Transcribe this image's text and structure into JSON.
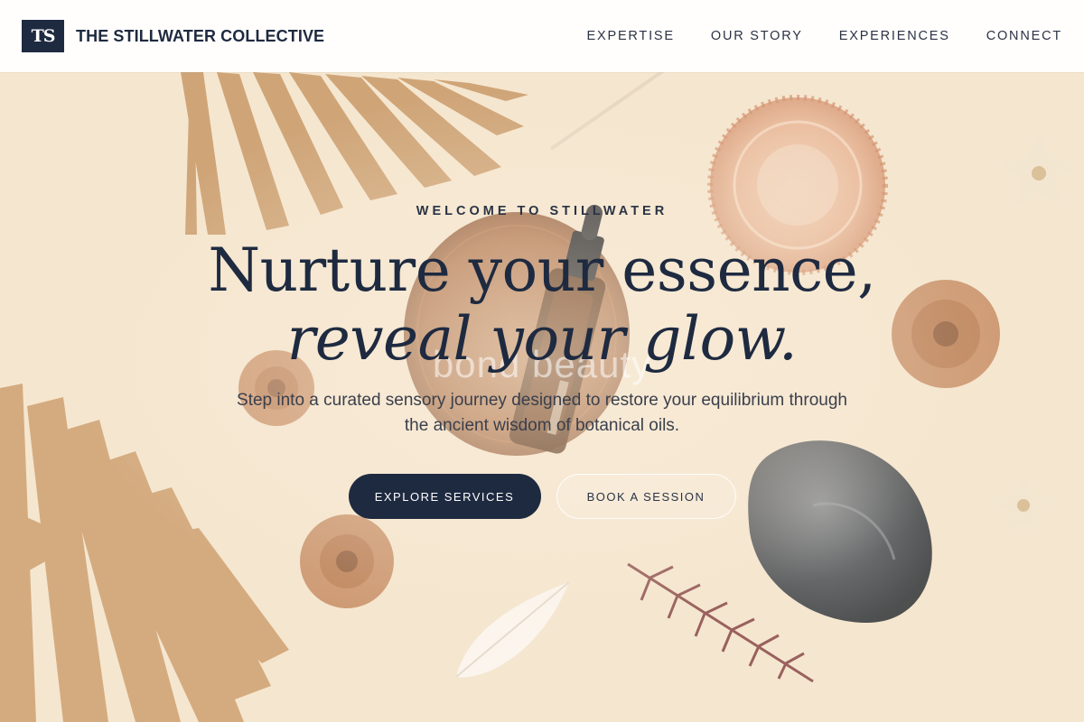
{
  "header": {
    "logo_text": "TS",
    "brand_name": "THE STILLWATER COLLECTIVE",
    "nav": [
      "EXPERTISE",
      "OUR STORY",
      "EXPERIENCES",
      "CONNECT"
    ]
  },
  "hero": {
    "eyebrow": "WELCOME TO STILLWATER",
    "headline_line1": "Nurture your essence,",
    "headline_line2": "reveal your glow.",
    "watermark": "bond beauty",
    "subtitle": "Step into a curated sensory journey designed to restore your equilibrium through the ancient wisdom of botanical oils.",
    "primary_cta": "EXPLORE SERVICES",
    "secondary_cta": "BOOK A SESSION"
  },
  "colors": {
    "navy": "#1e2a40",
    "background": "#f5e6cf",
    "header_bg": "#ffffff"
  }
}
